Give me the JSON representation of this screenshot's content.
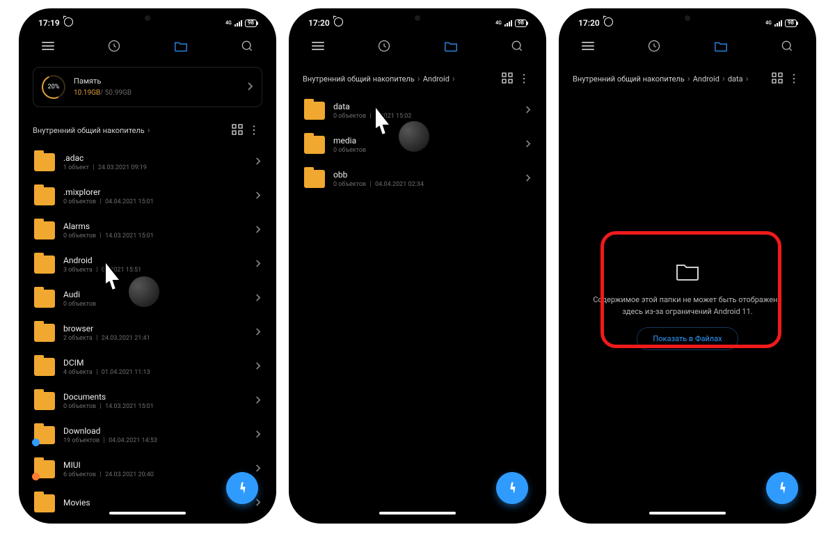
{
  "screens": [
    {
      "status": {
        "time": "17:19",
        "net": "4G",
        "battery": "98"
      },
      "storage": {
        "pct": "20%",
        "label": "Память",
        "used": "10.19GB",
        "total": "50.99GB"
      },
      "breadcrumb": [
        "Внутренний общий накопитель"
      ],
      "folders": [
        {
          "name": ".adac",
          "meta1": "1 объект",
          "meta2": "24.03.2021 09:19"
        },
        {
          "name": ".mixplorer",
          "meta1": "0 объектов",
          "meta2": "04.04.2021 15:01"
        },
        {
          "name": "Alarms",
          "meta1": "0 объектов",
          "meta2": "14.03.2021 15:01"
        },
        {
          "name": "Android",
          "meta1": "3 объекта",
          "meta2": "03.2021 15:51"
        },
        {
          "name": "Audi",
          "meta1": "0 объектов",
          "meta2": ""
        },
        {
          "name": "browser",
          "meta1": "2 объекта",
          "meta2": "24.03.2021 21:41"
        },
        {
          "name": "DCIM",
          "meta1": "4 объекта",
          "meta2": "01.04.2021 11:13"
        },
        {
          "name": "Documents",
          "meta1": "0 объектов",
          "meta2": "14.03.2021 15:01"
        },
        {
          "name": "Download",
          "meta1": "19 объектов",
          "meta2": "04.04.2021 14:53",
          "dot": "#2f9bff"
        },
        {
          "name": "MIUI",
          "meta1": "6 объектов",
          "meta2": "24.03.2021 20:40",
          "dot": "#ff7a2f"
        },
        {
          "name": "Movies",
          "meta1": "",
          "meta2": ""
        }
      ],
      "cursor_row": 3
    },
    {
      "status": {
        "time": "17:20",
        "net": "4G",
        "battery": "98"
      },
      "breadcrumb": [
        "Внутренний общий накопитель",
        "Android"
      ],
      "folders": [
        {
          "name": "data",
          "meta1": "0 объектов",
          "meta2": "4.2021 15:02"
        },
        {
          "name": "media",
          "meta1": "0 объектов",
          "meta2": ""
        },
        {
          "name": "obb",
          "meta1": "0 объектов",
          "meta2": "04.04.2021 02:34"
        }
      ],
      "cursor_row": 0
    },
    {
      "status": {
        "time": "17:20",
        "net": "4G",
        "battery": "98"
      },
      "breadcrumb": [
        "Внутренний общий накопитель",
        "Android",
        "data"
      ],
      "empty": {
        "text": "Содержимое этой папки не может быть отображено здесь из-за ограничений Android 11.",
        "button": "Показать в Файлах"
      }
    }
  ]
}
